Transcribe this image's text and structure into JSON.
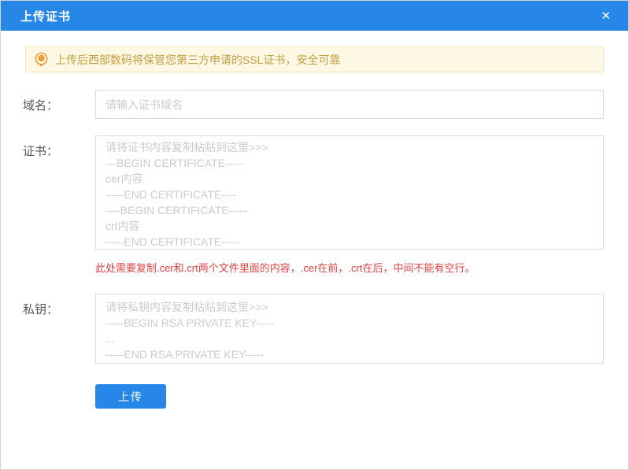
{
  "dialog": {
    "title": "上传证书",
    "close_icon": "✕"
  },
  "notice": {
    "text": "上传后西部数码将保管您第三方申请的SSL证书，安全可靠"
  },
  "form": {
    "domain": {
      "label": "域名：",
      "placeholder": "请输入证书域名"
    },
    "cert": {
      "label": "证书：",
      "placeholder": "请将证书内容复制粘贴到这里>>>\n---BEGIN CERTIFICATE-----\ncer内容\n-----END CERTIFICATE----\n----BEGIN CERTIFICATE-----\ncrt内容\n-----END CERTIFICATE-----",
      "note": "此处需要复制.cer和.crt两个文件里面的内容，.cer在前，.crt在后，中间不能有空行。"
    },
    "private_key": {
      "label": "私钥：",
      "placeholder": "请将私钥内容复制粘贴到这里>>>\n-----BEGIN RSA PRIVATE KEY-----\n...\n-----END RSA PRIVATE KEY-----"
    },
    "submit_label": "上传"
  },
  "colors": {
    "header_bg": "#2787e8",
    "button_bg": "#2787e8",
    "notice_bg": "#fdf8e4",
    "notice_border": "#f1e7c0",
    "notice_text": "#c3a042",
    "warning_text": "#e64242",
    "icon_bulb": "#f29b2e"
  }
}
